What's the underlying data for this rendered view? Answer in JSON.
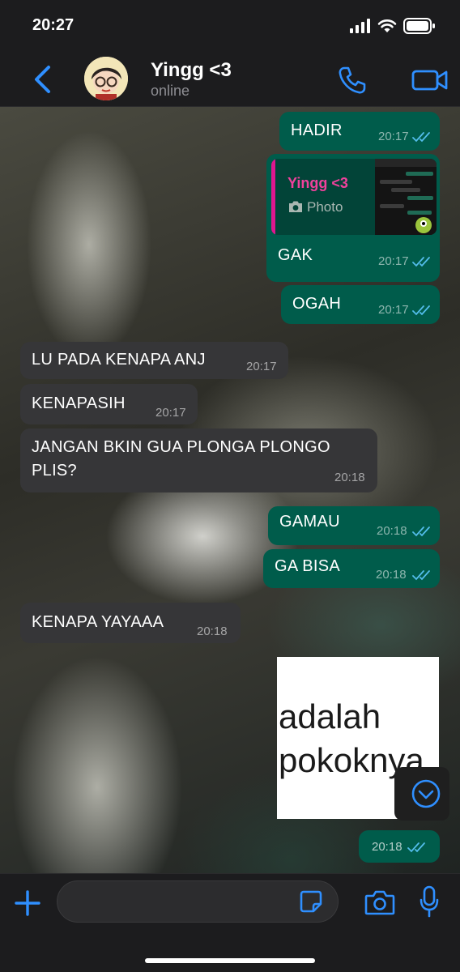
{
  "status_bar": {
    "time": "20:27"
  },
  "header": {
    "back_icon": "chevron-left-icon",
    "contact_name": "Yingg <3",
    "contact_status": "online",
    "call_icon": "phone-icon",
    "video_icon": "video-camera-icon"
  },
  "colors": {
    "accent": "#2f8fff",
    "outgoing_bubble": "#005c4b",
    "incoming_bubble": "#363638",
    "read_ticks": "#53bdeb",
    "reply_name": "#f0419c"
  },
  "messages": [
    {
      "direction": "out",
      "text": "HADIR",
      "time": "20:17",
      "read": true
    },
    {
      "direction": "out",
      "reply_to": {
        "name": "Yingg <3",
        "kind": "Photo"
      },
      "text": "GAK",
      "time": "20:17",
      "read": true
    },
    {
      "direction": "out",
      "text": "OGAH",
      "time": "20:17",
      "read": true
    },
    {
      "direction": "in",
      "text": "LU PADA KENAPA ANJ",
      "time": "20:17"
    },
    {
      "direction": "in",
      "text": "KENAPASIH",
      "time": "20:17"
    },
    {
      "direction": "in",
      "text_line1": "JANGAN BKIN GUA PLONGA PLONGO",
      "text_line2": "PLIS?",
      "time": "20:18"
    },
    {
      "direction": "out",
      "text": "GAMAU",
      "time": "20:18",
      "read": true
    },
    {
      "direction": "out",
      "text": "GA BISA",
      "time": "20:18",
      "read": true
    },
    {
      "direction": "in",
      "text": "KENAPA YAYAAA",
      "time": "20:18"
    },
    {
      "direction": "out",
      "type": "sticker",
      "sticker_line1": "adalah",
      "sticker_line2": "pokoknya",
      "time": "20:18",
      "read": true
    }
  ],
  "input": {
    "value": "",
    "placeholder": ""
  },
  "icons": {
    "plus": "plus-icon",
    "sticker": "sticker-icon",
    "camera": "camera-icon",
    "mic": "microphone-icon",
    "scroll_down": "chevron-down-circle-icon",
    "photo": "camera-small-icon"
  }
}
